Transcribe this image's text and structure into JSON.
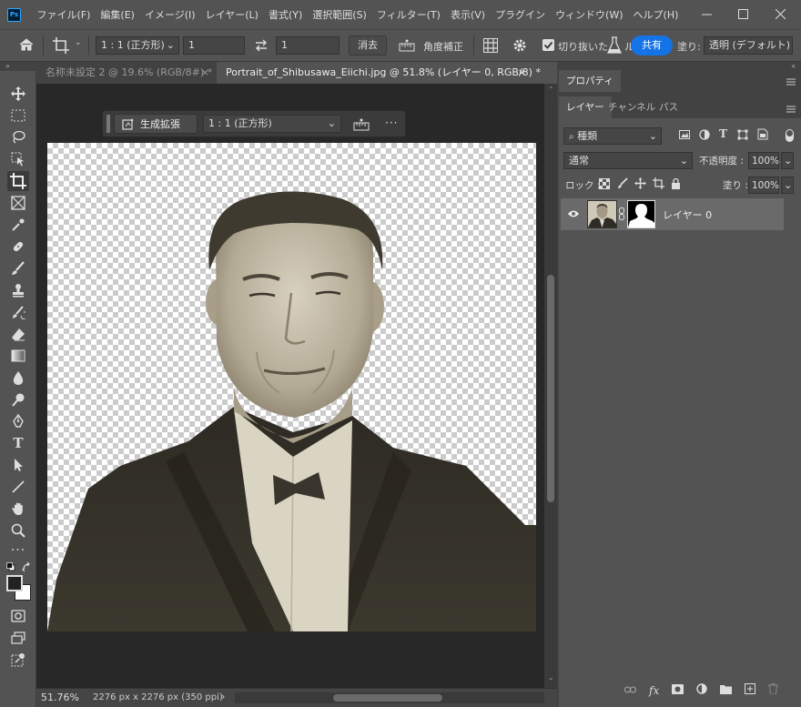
{
  "app": {
    "icon_text": "Ps",
    "accent": "#31a8ff"
  },
  "menu": [
    "ファイル(F)",
    "編集(E)",
    "イメージ(I)",
    "レイヤー(L)",
    "書式(Y)",
    "選択範囲(S)",
    "フィルター(T)",
    "表示(V)",
    "プラグイン",
    "ウィンドウ(W)",
    "ヘルプ(H)"
  ],
  "options": {
    "ratio_select": "1 : 1 (正方形)",
    "width_value": "1",
    "height_value": "1",
    "clear_label": "消去",
    "straighten_label": "角度補正",
    "delete_cropped_label": "切り抜いた",
    "share_label": "共有",
    "fill_label": "塗り:",
    "fill_select": "透明 (デフォルト)"
  },
  "tabs": [
    {
      "label": "名称未設定 2 @ 19.6% (RGB/8#) *",
      "close": "×"
    },
    {
      "label": "Portrait_of_Shibusawa_Eiichi.jpg @ 51.8% (レイヤー 0, RGB/8) *",
      "close": "×"
    }
  ],
  "context_bar": {
    "generate_label": "生成拡張",
    "ratio_select": "1 : 1 (正方形)",
    "more": "···"
  },
  "status": {
    "zoom": "51.76%",
    "doc_size": "2276 px x 2276 px (350 ppi)",
    "arrow": "›"
  },
  "panels": {
    "properties_tab": "プロパティ",
    "layer_tabs": [
      "レイヤー",
      "チャンネル",
      "パス"
    ],
    "filter_select": "種類",
    "blend_mode": "通常",
    "opacity_label": "不透明度 :",
    "opacity_value": "100%",
    "lock_label": "ロック :",
    "fill_label": "塗り :",
    "fill_value": "100%"
  },
  "layers": [
    {
      "name": "レイヤー 0",
      "visible": true,
      "has_mask": true
    }
  ],
  "colors": {
    "ui_bg": "#535353",
    "panel_dark": "#424242",
    "canvas_bg": "#282828",
    "accent": "#1473e6"
  }
}
